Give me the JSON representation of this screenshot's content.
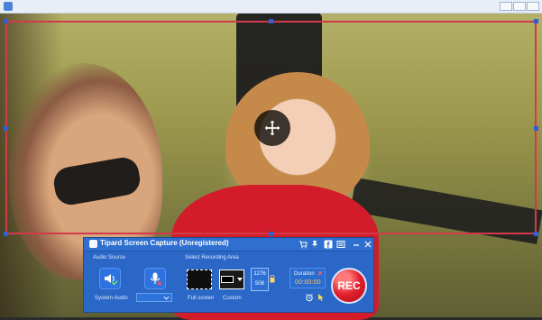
{
  "app": {
    "title": "Tipard Screen Capture (Unregistered)",
    "titlebar_icons": [
      "cart-icon",
      "pin-icon",
      "facebook-icon",
      "menu-icon",
      "minimize-icon",
      "close-icon"
    ]
  },
  "labels": {
    "audio_source": "Audio Source",
    "select_recording_area": "Select Recording Area",
    "system_audio": "System Audio",
    "full_screen": "Full screen",
    "custom": "Custom",
    "duration": "Duration"
  },
  "recording_area": {
    "width": "1276",
    "height": "508"
  },
  "duration_value": "00:00:00",
  "rec_button": "REC",
  "colors": {
    "panel_blue": "#2a67c7",
    "selection_red": "#d23a4a",
    "handle_blue": "#2f5fd6",
    "rec_red": "#e11f2b"
  }
}
